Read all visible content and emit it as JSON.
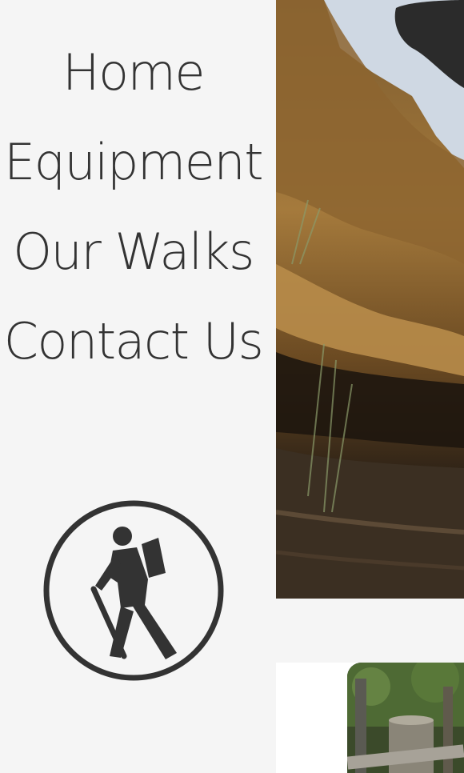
{
  "nav": {
    "items": [
      {
        "label": "Home"
      },
      {
        "label": "Equipment"
      },
      {
        "label": "Our Walks"
      },
      {
        "label": "Contact Us"
      }
    ]
  },
  "logo": {
    "icon": "hiker-icon",
    "color": "#333333"
  },
  "hero": {
    "image": "sandstone-cliff-photo"
  },
  "card": {
    "image": "wooden-fence-post-photo"
  },
  "colors": {
    "background": "#f5f5f5",
    "text": "#333333",
    "card": "#ffffff"
  }
}
